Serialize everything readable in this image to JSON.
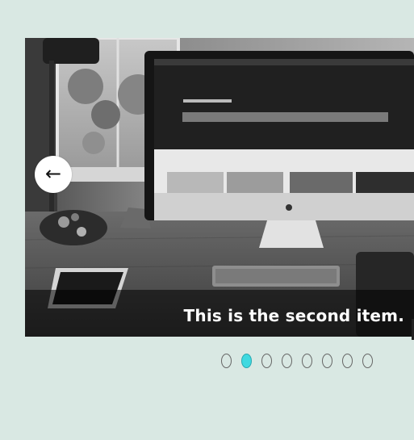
{
  "carousel": {
    "caption": "This is the second item.",
    "prev_arrow": "←",
    "image_icon": "desk-computer-photo",
    "prev_icon": "arrow-left-icon",
    "dot_count": 8,
    "active_index": 1,
    "colors": {
      "page_background": "#d9e8e3",
      "active_dot": "#3fd9e0",
      "inactive_dot_border": "#666666"
    }
  }
}
